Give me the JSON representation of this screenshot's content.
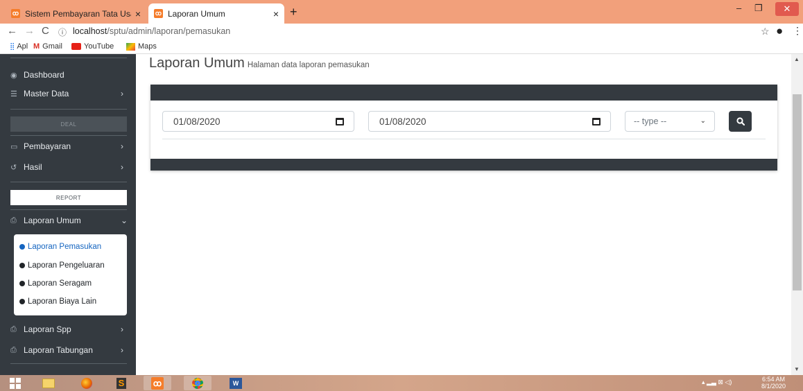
{
  "browser": {
    "tabs": [
      {
        "title": "Sistem Pembayaran Tata Usaha",
        "close": "×"
      },
      {
        "title": "Laporan Umum",
        "close": "×"
      }
    ],
    "new_tab": "+",
    "url_host": "localhost",
    "url_path": "/sptu/admin/laporan/pemasukan",
    "bookmarks": [
      "Apl",
      "Gmail",
      "YouTube",
      "Maps"
    ]
  },
  "sidebar": {
    "dashboard": "Dashboard",
    "master_data": "Master Data",
    "header_deal": "DEAL",
    "pembayaran": "Pembayaran",
    "hasil": "Hasil",
    "header_report": "REPORT",
    "laporan_umum": "Laporan Umum",
    "sub": [
      "Laporan Pemasukan",
      "Laporan Pengeluaran",
      "Laporan Seragam",
      "Laporan Biaya Lain"
    ],
    "laporan_spp": "Laporan Spp",
    "laporan_tabungan": "Laporan Tabungan"
  },
  "main": {
    "title": "Laporan Umum",
    "subtitle": "Halaman data laporan pemasukan",
    "date_from": "01/08/2020",
    "date_to": "01/08/2020",
    "type_select": "-- type --"
  },
  "taskbar": {
    "time": "6:54 AM",
    "date": "8/1/2020"
  },
  "colors": {
    "tabstrip": "#f2a07b",
    "sidebar": "#343a40",
    "active_link": "#1565c0"
  }
}
